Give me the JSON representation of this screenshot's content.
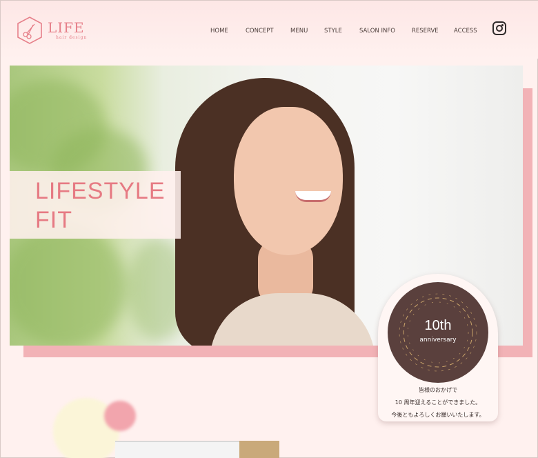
{
  "brand": {
    "name": "LIFE",
    "subtitle": "hair design"
  },
  "nav": {
    "items": [
      {
        "label": "HOME"
      },
      {
        "label": "CONCEPT"
      },
      {
        "label": "MENU"
      },
      {
        "label": "STYLE"
      },
      {
        "label": "SALON INFO"
      },
      {
        "label": "RESERVE"
      },
      {
        "label": "ACCESS"
      }
    ],
    "social_icon": "instagram-icon"
  },
  "hero": {
    "tagline": [
      "LIFESTYLE",
      "FIT"
    ]
  },
  "anniversary": {
    "number": "10th",
    "word": "anniversary",
    "message": [
      "皆様のおかげで",
      "10 周年迎えることができました。",
      "今後ともよろしくお願いいたします。"
    ]
  },
  "colors": {
    "background": "#fff1ef",
    "accent_pink": "#e67a83",
    "hero_shadow": "#f2b2b6",
    "badge_brown": "#5a403d",
    "badge_gold": "#c9a36a"
  }
}
